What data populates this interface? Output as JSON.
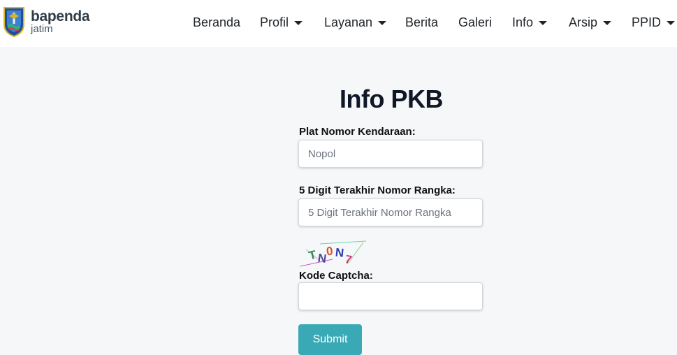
{
  "brand": {
    "line1": "bapenda",
    "line2": "jatim"
  },
  "nav": {
    "items": [
      {
        "label": "Beranda",
        "dropdown": false
      },
      {
        "label": "Profil",
        "dropdown": true
      },
      {
        "label": "Layanan",
        "dropdown": true
      },
      {
        "label": "Berita",
        "dropdown": false
      },
      {
        "label": "Galeri",
        "dropdown": false
      },
      {
        "label": "Info",
        "dropdown": true
      },
      {
        "label": "Arsip",
        "dropdown": true
      },
      {
        "label": "PPID",
        "dropdown": true
      }
    ]
  },
  "form": {
    "title": "Info PKB",
    "plat_label": "Plat Nomor Kendaraan:",
    "plat_placeholder": "Nopol",
    "plat_value": "",
    "rangka_label": "5 Digit Terakhir Nomor Rangka:",
    "rangka_placeholder": "5 Digit Terakhir Nomor Rangka",
    "rangka_value": "",
    "captcha_label": "Kode Captcha:",
    "captcha_value": "",
    "submit_label": "Submit"
  },
  "captcha": {
    "text": "TN0N7",
    "chars": [
      "T",
      "N",
      "0",
      "N",
      "7"
    ]
  },
  "colors": {
    "page_bg": "#f6f7f9",
    "navbar_bg": "#ffffff",
    "title": "#101828",
    "submit_bg": "#3aa9b6"
  }
}
